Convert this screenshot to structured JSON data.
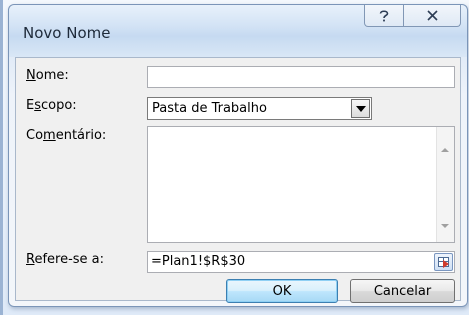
{
  "dialog": {
    "title": "Novo Nome",
    "help_icon": "help-icon",
    "close_icon": "close-icon"
  },
  "fields": {
    "name": {
      "label_first": "N",
      "label_rest": "ome:",
      "value": ""
    },
    "scope": {
      "label_first": "E",
      "label_underlined": "s",
      "label_rest": "copo:",
      "value": "Pasta de Trabalho"
    },
    "comment": {
      "label_first": "Co",
      "label_underlined": "m",
      "label_rest": "entário:",
      "value": ""
    },
    "refers_to": {
      "label_underlined": "R",
      "label_rest": "efere-se a:",
      "value": "=Plan1!$R$30",
      "collapse_icon": "range-select-icon"
    }
  },
  "buttons": {
    "ok": "OK",
    "cancel": "Cancelar"
  },
  "colors": {
    "ok_accent": "#3c7fb1",
    "title_text": "#1e2a3a"
  }
}
